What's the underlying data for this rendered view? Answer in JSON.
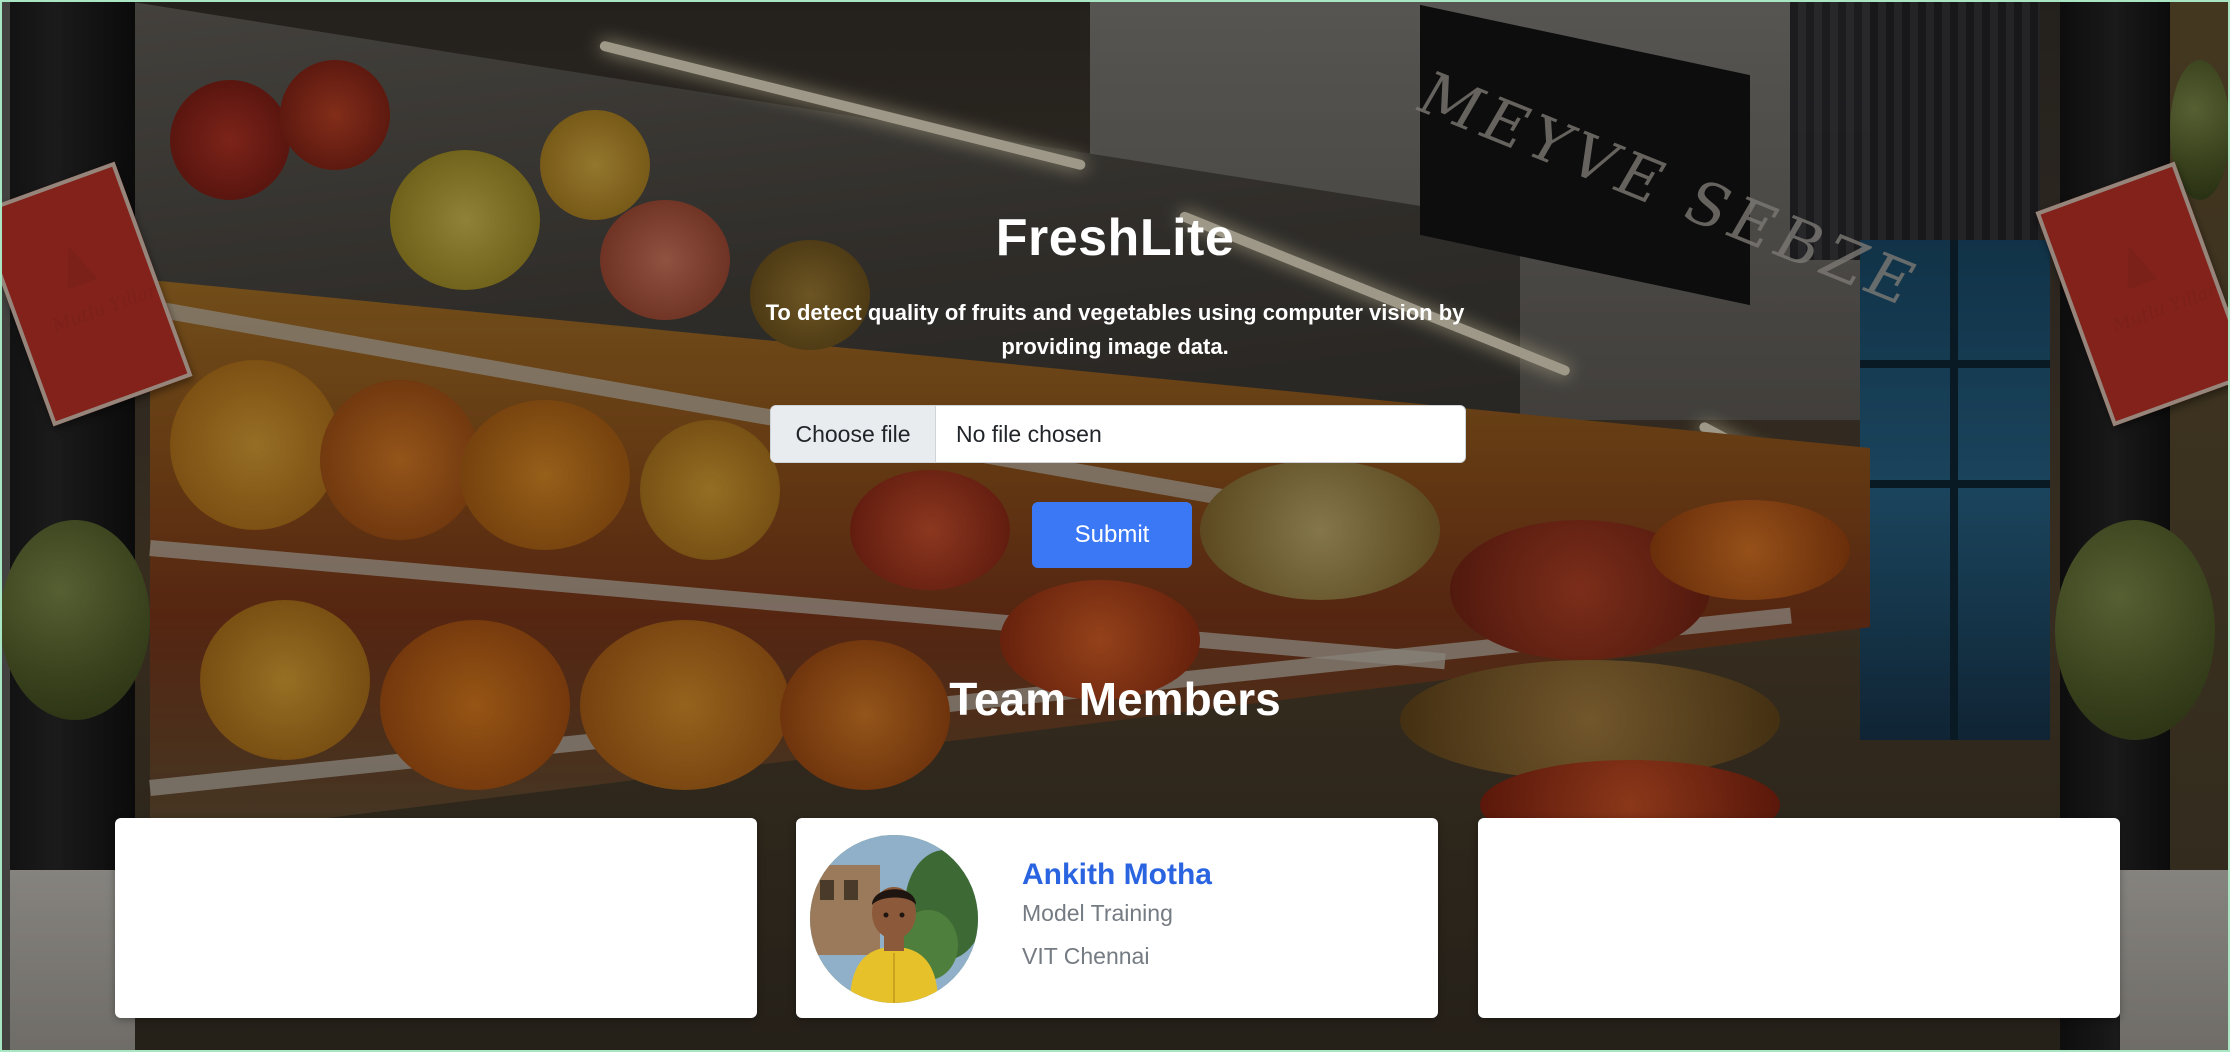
{
  "app": {
    "title": "FreshLite",
    "subtitle": "To detect quality of fruits and vegetables using computer vision by providing image data."
  },
  "upload": {
    "choose_label": "Choose file",
    "status": "No file chosen",
    "submit_label": "Submit"
  },
  "team": {
    "heading": "Team Members",
    "members": [
      {
        "name": "Ankith Motha",
        "role": "Model Training",
        "school": "VIT Chennai"
      }
    ]
  },
  "colors": {
    "accent": "#3b78f6",
    "name_link": "#2a64e0",
    "muted_text": "#747b82"
  },
  "icons": {
    "file": "file-icon",
    "avatar": "person-avatar"
  }
}
